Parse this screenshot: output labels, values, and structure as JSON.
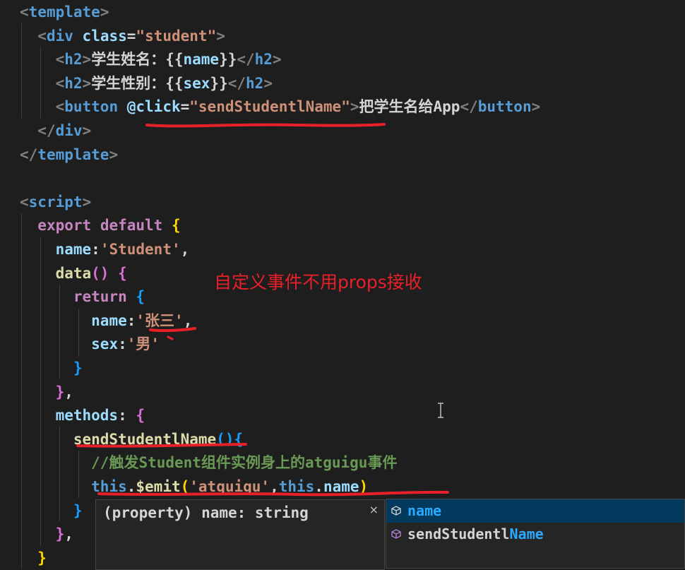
{
  "code_lines": [
    [
      [
        "<",
        "pun"
      ],
      [
        "template",
        "tag"
      ],
      [
        ">",
        "pun"
      ]
    ],
    [
      [
        "  ",
        "txt"
      ],
      [
        "<",
        "pun"
      ],
      [
        "div",
        "tag"
      ],
      [
        " ",
        "txt"
      ],
      [
        "class",
        "attr"
      ],
      [
        "=",
        "txt"
      ],
      [
        "\"student\"",
        "str"
      ],
      [
        ">",
        "pun"
      ]
    ],
    [
      [
        "    ",
        "txt"
      ],
      [
        "<",
        "pun"
      ],
      [
        "h2",
        "tag"
      ],
      [
        ">",
        "pun"
      ],
      [
        "学生姓名：",
        "txt"
      ],
      [
        "{{",
        "txt"
      ],
      [
        "name",
        "key"
      ],
      [
        "}}",
        "txt"
      ],
      [
        "</",
        "pun"
      ],
      [
        "h2",
        "tag"
      ],
      [
        ">",
        "pun"
      ]
    ],
    [
      [
        "    ",
        "txt"
      ],
      [
        "<",
        "pun"
      ],
      [
        "h2",
        "tag"
      ],
      [
        ">",
        "pun"
      ],
      [
        "学生性别：",
        "txt"
      ],
      [
        "{{",
        "txt"
      ],
      [
        "sex",
        "key"
      ],
      [
        "}}",
        "txt"
      ],
      [
        "</",
        "pun"
      ],
      [
        "h2",
        "tag"
      ],
      [
        ">",
        "pun"
      ]
    ],
    [
      [
        "    ",
        "txt"
      ],
      [
        "<",
        "pun"
      ],
      [
        "button",
        "tag"
      ],
      [
        " ",
        "txt"
      ],
      [
        "@click",
        "attr"
      ],
      [
        "=",
        "txt"
      ],
      [
        "\"sendStudentlName\"",
        "str"
      ],
      [
        ">",
        "pun"
      ],
      [
        "把学生名给App",
        "txt"
      ],
      [
        "</",
        "pun"
      ],
      [
        "button",
        "tag"
      ],
      [
        ">",
        "pun"
      ]
    ],
    [
      [
        "  ",
        "txt"
      ],
      [
        "</",
        "pun"
      ],
      [
        "div",
        "tag"
      ],
      [
        ">",
        "pun"
      ]
    ],
    [
      [
        "</",
        "pun"
      ],
      [
        "template",
        "tag"
      ],
      [
        ">",
        "pun"
      ]
    ],
    [],
    [
      [
        "<",
        "pun"
      ],
      [
        "script",
        "tag"
      ],
      [
        ">",
        "pun"
      ]
    ],
    [
      [
        "  ",
        "txt"
      ],
      [
        "export",
        "kw"
      ],
      [
        " ",
        "txt"
      ],
      [
        "default",
        "kw"
      ],
      [
        " ",
        "txt"
      ],
      [
        "{",
        "br1"
      ]
    ],
    [
      [
        "    ",
        "txt"
      ],
      [
        "name",
        "key"
      ],
      [
        ":",
        "txt"
      ],
      [
        "'Student'",
        "str"
      ],
      [
        ",",
        "txt"
      ]
    ],
    [
      [
        "    ",
        "txt"
      ],
      [
        "data",
        "fn"
      ],
      [
        "()",
        "br2"
      ],
      [
        " ",
        "txt"
      ],
      [
        "{",
        "br2"
      ]
    ],
    [
      [
        "      ",
        "txt"
      ],
      [
        "return",
        "kw"
      ],
      [
        " ",
        "txt"
      ],
      [
        "{",
        "br3"
      ]
    ],
    [
      [
        "        ",
        "txt"
      ],
      [
        "name",
        "key"
      ],
      [
        ":",
        "txt"
      ],
      [
        "'张三'",
        "str"
      ],
      [
        ",",
        "txt"
      ]
    ],
    [
      [
        "        ",
        "txt"
      ],
      [
        "sex",
        "key"
      ],
      [
        ":",
        "txt"
      ],
      [
        "'男'",
        "str"
      ]
    ],
    [
      [
        "      ",
        "txt"
      ],
      [
        "}",
        "br3"
      ]
    ],
    [
      [
        "    ",
        "txt"
      ],
      [
        "}",
        "br2"
      ],
      [
        ",",
        "txt"
      ]
    ],
    [
      [
        "    ",
        "txt"
      ],
      [
        "methods",
        "key"
      ],
      [
        ":",
        "txt"
      ],
      [
        " ",
        "txt"
      ],
      [
        "{",
        "br2"
      ]
    ],
    [
      [
        "      ",
        "txt"
      ],
      [
        "sendStudentlName",
        "fn"
      ],
      [
        "()",
        "br3"
      ],
      [
        "{",
        "br3"
      ]
    ],
    [
      [
        "        ",
        "txt"
      ],
      [
        "//触发Student组件实例身上的atguigu事件",
        "com"
      ]
    ],
    [
      [
        "        ",
        "txt"
      ],
      [
        "this",
        "this"
      ],
      [
        ".",
        "txt"
      ],
      [
        "$emit",
        "fn"
      ],
      [
        "(",
        "br1"
      ],
      [
        "'atguigu'",
        "str"
      ],
      [
        ",",
        "txt"
      ],
      [
        "this",
        "this"
      ],
      [
        ".",
        "txt"
      ],
      [
        "name",
        "key"
      ],
      [
        ")",
        "br1"
      ]
    ],
    [
      [
        "      ",
        "txt"
      ],
      [
        "}",
        "br3"
      ]
    ],
    [
      [
        "    ",
        "txt"
      ],
      [
        "}",
        "br2"
      ],
      [
        ",",
        "txt"
      ]
    ],
    [
      [
        "  ",
        "txt"
      ],
      [
        "}",
        "br1"
      ]
    ]
  ],
  "annotation": "自定义事件不用props接收",
  "hover_widget": {
    "text": "(property) name: string",
    "close_symbol": "×"
  },
  "suggestions": [
    {
      "label": "name",
      "match": "name",
      "prefix": "",
      "icon": "property-icon",
      "selected": true
    },
    {
      "label": "sendStudentlName",
      "prefix": "sendStudentl",
      "match": "Name",
      "icon": "method-icon",
      "selected": false
    }
  ],
  "colors": {
    "background": "#1e1e1e",
    "tag": "#569cd6",
    "string": "#ce9178",
    "keyword": "#c586c0",
    "property": "#9cdcfe",
    "function": "#dcdcaa",
    "comment": "#6a9955",
    "annotation_red": "#e8202a",
    "suggest_selected": "#04395e",
    "suggest_match": "#2aaaff"
  }
}
